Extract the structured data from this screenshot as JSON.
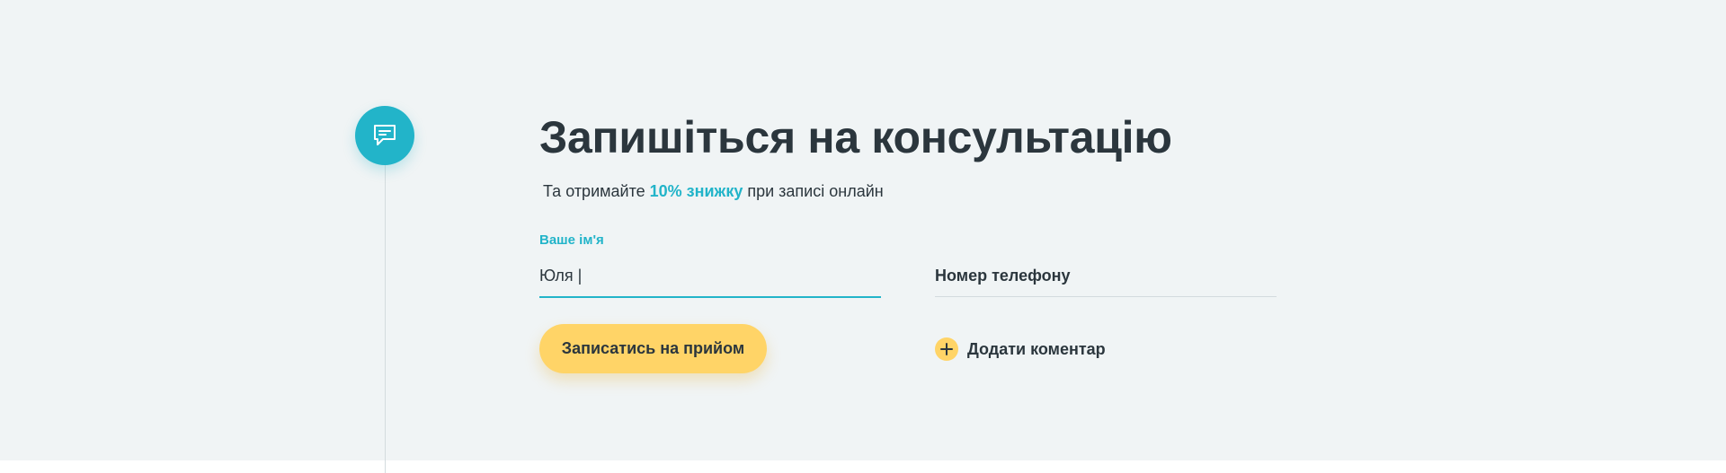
{
  "colors": {
    "accent": "#22b4c9",
    "button": "#ffd467",
    "text": "#2b363d",
    "background": "#f0f4f5"
  },
  "icons": {
    "badge": "chat-bubble-icon",
    "add": "plus-icon"
  },
  "form": {
    "title": "Запишіться на консультацію",
    "subtitle_before": "Та отримайте",
    "subtitle_accent": "10% знижку",
    "subtitle_after": "при записі онлайн",
    "name_label": "Ваше ім'я",
    "name_value": "Юля |",
    "phone_placeholder": "Номер телефону",
    "submit_label": "Записатись на прийом",
    "add_comment_label": "Додати коментар"
  }
}
